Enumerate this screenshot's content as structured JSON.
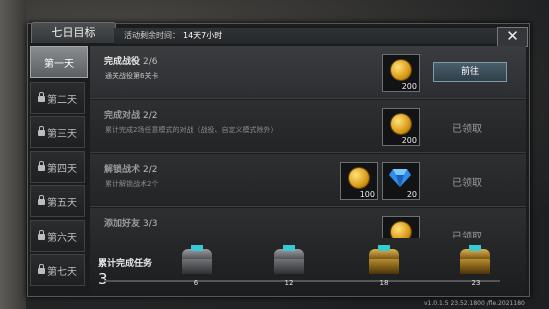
{
  "window": {
    "title": "七日目标",
    "timer_label": "活动剩余时间：",
    "timer_value": "14天7小时",
    "close_symbol": "✕"
  },
  "days": [
    {
      "label": "第一天",
      "locked": false,
      "active": true
    },
    {
      "label": "第二天",
      "locked": true
    },
    {
      "label": "第三天",
      "locked": true
    },
    {
      "label": "第四天",
      "locked": true
    },
    {
      "label": "第五天",
      "locked": true
    },
    {
      "label": "第六天",
      "locked": true
    },
    {
      "label": "第七天",
      "locked": true
    }
  ],
  "tasks": [
    {
      "title": "完成战役",
      "progress": "2/6",
      "desc": "通关战役第6关卡",
      "rewards": [
        {
          "icon": "gold-coin-icon",
          "qty": "200"
        }
      ],
      "action": "前往",
      "status": "pending"
    },
    {
      "title": "完成对战",
      "progress": "2/2",
      "desc": "累计完成2场任意模式的对战（战役、自定义模式除外）",
      "rewards": [
        {
          "icon": "gold-coin-icon",
          "qty": "200"
        }
      ],
      "action": "已领取",
      "status": "claimed"
    },
    {
      "title": "解锁战术",
      "progress": "2/2",
      "desc": "累计解锁战术2个",
      "rewards": [
        {
          "icon": "gold-coin-icon",
          "qty": "100"
        },
        {
          "icon": "diamond-icon",
          "qty": "20"
        }
      ],
      "action": "已领取",
      "status": "claimed"
    },
    {
      "title": "添加好友",
      "progress": "3/3",
      "desc": "",
      "rewards": [
        {
          "icon": "gold-coin-icon",
          "qty": ""
        }
      ],
      "action": "已领取",
      "status": "claimed"
    }
  ],
  "footer": {
    "label": "累计完成任务",
    "count": "3",
    "chests": [
      {
        "icon": "gray-chest-icon",
        "threshold": "6"
      },
      {
        "icon": "gray-chest-icon",
        "threshold": "12"
      },
      {
        "icon": "gold-chest-icon",
        "threshold": "18"
      },
      {
        "icon": "gold-chest-icon",
        "threshold": "23"
      }
    ]
  },
  "version": "v1.0.1.5 23.52.1800 /fle.2021180"
}
